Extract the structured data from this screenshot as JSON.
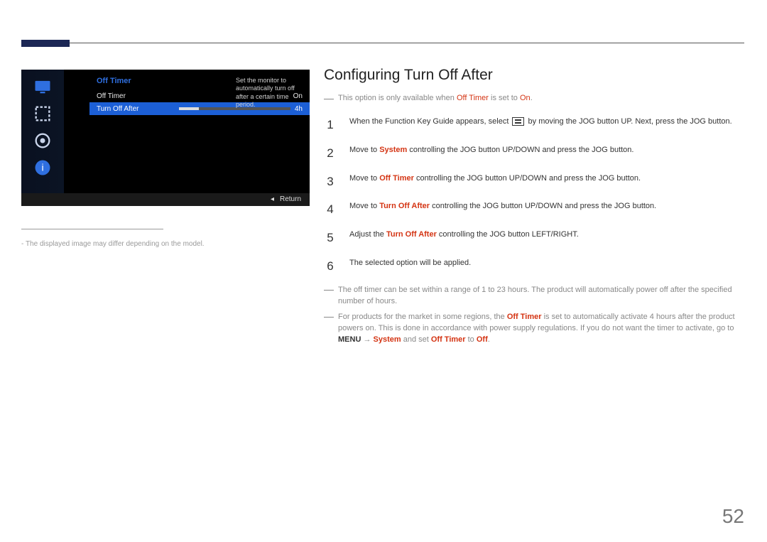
{
  "page_number": "52",
  "heading": "Configuring Turn Off After",
  "note1_prefix": "This option is only available when ",
  "note1_hl1": "Off Timer",
  "note1_mid": " is set to ",
  "note1_hl2": "On",
  "note1_suffix": ".",
  "image_caption": "The displayed image may differ depending on the model.",
  "osd": {
    "title": "Off Timer",
    "row1_label": "Off Timer",
    "row1_val": "On",
    "row2_label": "Turn Off After",
    "row2_val": "4h",
    "help": "Set the monitor to automatically turn off after a certain time period.",
    "return": "Return"
  },
  "steps": {
    "s1a": "When the Function Key Guide appears, select ",
    "s1b": " by moving the JOG button UP. Next, press the JOG button.",
    "s2a": "Move to ",
    "s2hl": "System",
    "s2b": " controlling the JOG button UP/DOWN and press the JOG button.",
    "s3a": "Move to ",
    "s3hl": "Off Timer",
    "s3b": " controlling the JOG button UP/DOWN and press the JOG button.",
    "s4a": "Move to ",
    "s4hl": "Turn Off After",
    "s4b": " controlling the JOG button UP/DOWN and press the JOG button.",
    "s5a": "Adjust the ",
    "s5hl": "Turn Off After",
    "s5b": " controlling the JOG button LEFT/RIGHT.",
    "s6": "The selected option will be applied."
  },
  "foot1": "The off timer can be set within a range of 1 to 23 hours. The product will automatically power off after the specified number of hours.",
  "foot2a": "For products for the market in some regions, the ",
  "foot2hl1": "Off Timer",
  "foot2b": " is set to automatically activate 4 hours after the product powers on. This is done in accordance with power supply regulations. If you do not want the timer to activate, go to ",
  "foot2menu": "MENU",
  "foot2arrow": " → ",
  "foot2hl2": "System",
  "foot2c": " and set ",
  "foot2hl3": "Off Timer",
  "foot2d": " to ",
  "foot2hl4": "Off",
  "foot2e": "."
}
